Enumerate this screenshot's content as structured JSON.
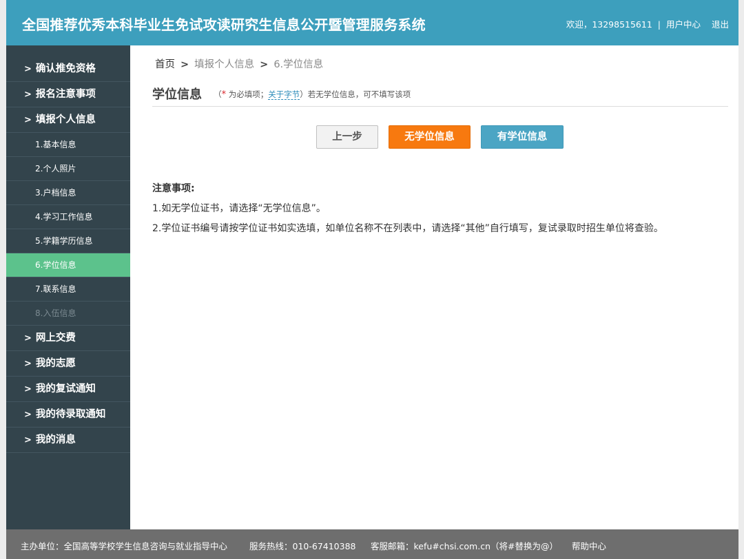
{
  "header": {
    "title": "全国推荐优秀本科毕业生免试攻读研究生信息公开暨管理服务系统",
    "welcome": "欢迎，13298515611",
    "separator": "|",
    "user_center": "用户中心",
    "logout": "退出"
  },
  "sidebar": {
    "chevron": ">",
    "items": [
      {
        "label": "确认推免资格"
      },
      {
        "label": "报名注意事项"
      },
      {
        "label": "填报个人信息"
      }
    ],
    "subitems": [
      {
        "label": "1.基本信息"
      },
      {
        "label": "2.个人照片"
      },
      {
        "label": "3.户档信息"
      },
      {
        "label": "4.学习工作信息"
      },
      {
        "label": "5.学籍学历信息"
      },
      {
        "label": "6.学位信息"
      },
      {
        "label": "7.联系信息"
      },
      {
        "label": "8.入伍信息"
      }
    ],
    "bottom_items": [
      {
        "label": "网上交费"
      },
      {
        "label": "我的志愿"
      },
      {
        "label": "我的复试通知"
      },
      {
        "label": "我的待录取通知"
      },
      {
        "label": "我的消息"
      }
    ],
    "active_color": "#5cc28c",
    "bg_color": "#33444c"
  },
  "breadcrumb": {
    "home": "首页",
    "level1": "填报个人信息",
    "current": "6.学位信息",
    "arrow": ">"
  },
  "page": {
    "title": "学位信息",
    "note_open": "（",
    "required_mark": "*",
    "required_text": " 为必填项；",
    "about_link": "关于字节",
    "note_close": "）若无学位信息，可不填写该项"
  },
  "buttons": {
    "back": "上一步",
    "no_degree": "无学位信息",
    "has_degree": "有学位信息"
  },
  "notice": {
    "title": "注意事项:",
    "lines": [
      "1.如无学位证书，请选择“无学位信息”。",
      "2.学位证书编号请按学位证书如实选填，如单位名称不在列表中，请选择“其他”自行填写，复试录取时招生单位将查验。"
    ]
  },
  "footer": {
    "organizer": "主办单位：全国高等学校学生信息咨询与就业指导中心",
    "hotline": "服务热线：010-67410388",
    "email": "客服邮箱：kefu#chsi.com.cn（将#替换为@）",
    "help": "帮助中心"
  },
  "colors": {
    "header": "#3d9fbd",
    "orange_button": "#f7790f",
    "blue_button": "#4ba5c4",
    "footer": "#6e6e6e"
  }
}
